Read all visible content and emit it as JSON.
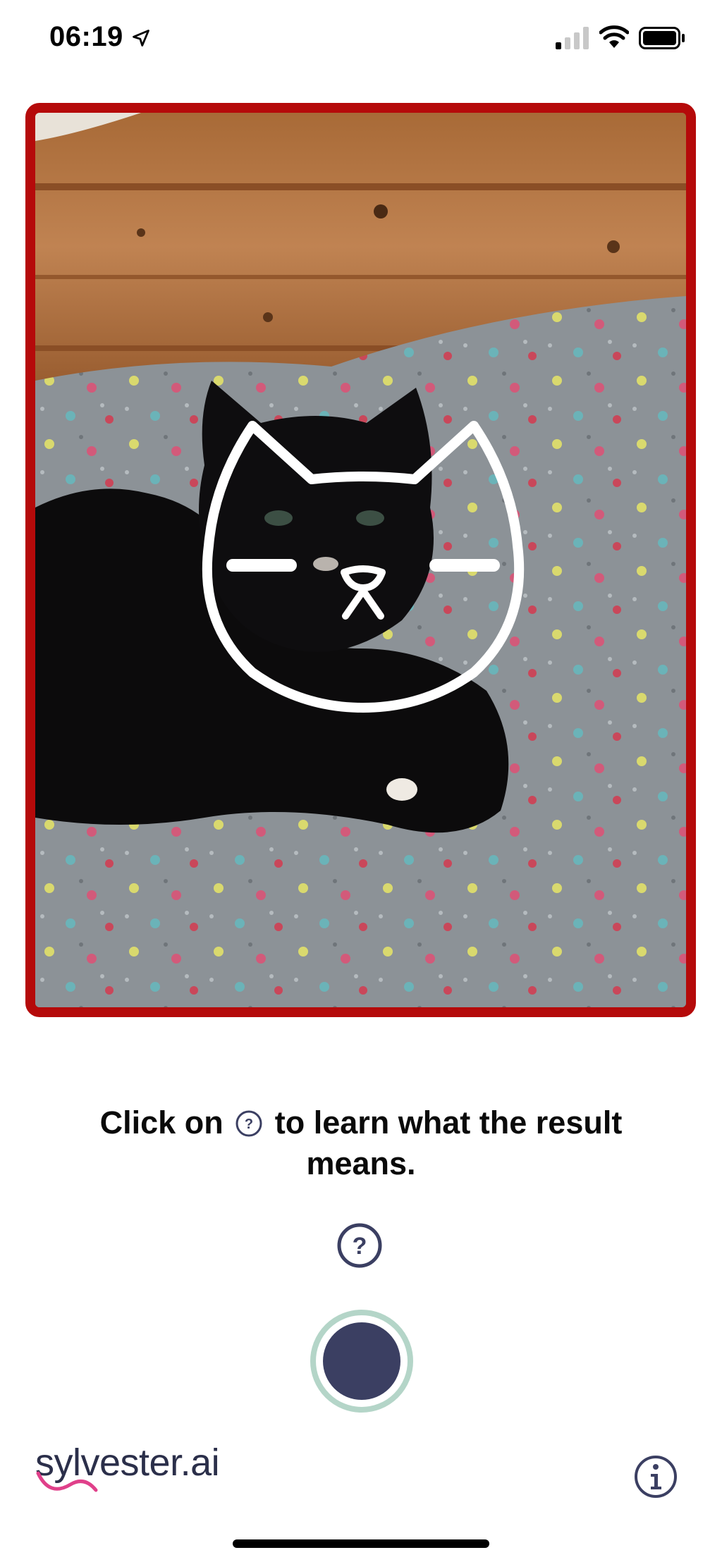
{
  "status_bar": {
    "time": "06:19",
    "icons": [
      "location-arrow-icon",
      "cellular-signal-icon",
      "wifi-icon",
      "battery-icon"
    ]
  },
  "camera": {
    "result_frame_color": "#b50a0a",
    "overlay_icon": "cat-face-icon"
  },
  "instruction": {
    "before_icon": "Click on",
    "after_icon": "to learn what the result means."
  },
  "help_button": {
    "icon": "question-icon"
  },
  "capture_button": {
    "ring_color": "#b4d5c8",
    "fill_color": "#3b3f62"
  },
  "footer": {
    "logo_text": "sylvester.ai",
    "info_icon": "info-icon"
  }
}
